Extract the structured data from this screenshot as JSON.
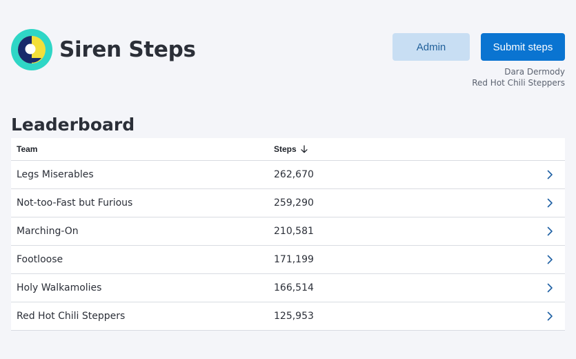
{
  "app": {
    "title": "Siren Steps",
    "logo_icon": "siren-logo-icon"
  },
  "header": {
    "admin_label": "Admin",
    "submit_label": "Submit steps",
    "user_name": "Dara Dermody",
    "user_team": "Red Hot Chili Steppers"
  },
  "leaderboard": {
    "title": "Leaderboard",
    "columns": {
      "team": "Team",
      "steps": "Steps"
    },
    "sort": {
      "column": "steps",
      "direction": "descending",
      "icon": "arrow-down-icon"
    },
    "rows": [
      {
        "team": "Legs Miserables",
        "steps": "262,670"
      },
      {
        "team": "Not-too-Fast but Furious",
        "steps": "259,290"
      },
      {
        "team": "Marching-On",
        "steps": "210,581"
      },
      {
        "team": "Footloose",
        "steps": "171,199"
      },
      {
        "team": "Holy Walkamolies",
        "steps": "166,514"
      },
      {
        "team": "Red Hot Chili Steppers",
        "steps": "125,953"
      }
    ]
  },
  "colors": {
    "background": "#f4f5f9",
    "primary": "#0a74d1",
    "primary_light": "#c8def3",
    "logo_teal": "#2fd6c6",
    "logo_yellow": "#f3df3a",
    "logo_navy": "#182a6b"
  }
}
